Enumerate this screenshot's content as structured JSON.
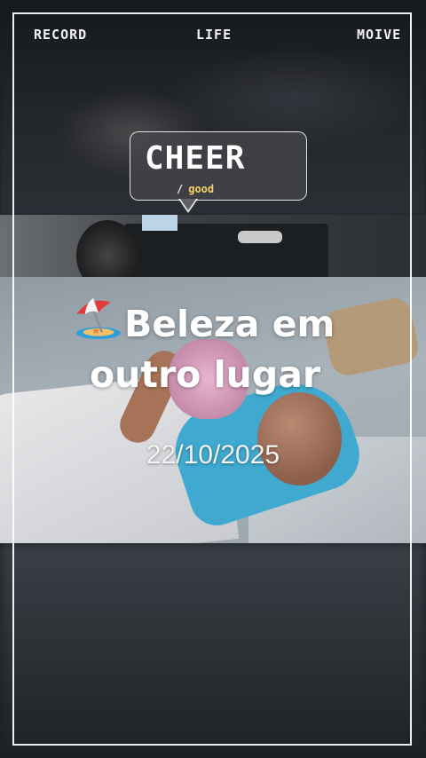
{
  "top_labels": {
    "left": "RECORD",
    "center": "LIFE",
    "right": "MOIVE"
  },
  "bubble": {
    "title": "CHEER",
    "slash": "/",
    "subtitle": "good"
  },
  "headline": {
    "emoji": "beach-umbrella-icon",
    "line1": "Beleza em",
    "line2": "outro lugar"
  },
  "date": "22/10/2025",
  "colors": {
    "frame": "#ffffff",
    "subtitle": "#f6d36a",
    "bubble_fill": "#46484c"
  }
}
